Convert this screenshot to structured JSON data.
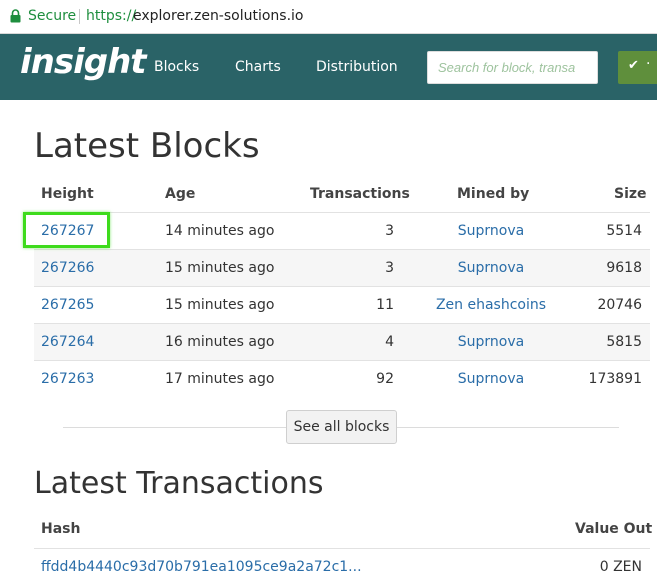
{
  "browser": {
    "secure_label": "Secure",
    "url_protocol": "https://",
    "url_host": "explorer.zen-solutions.io"
  },
  "navbar": {
    "logo": "insight",
    "links": [
      "Blocks",
      "Charts",
      "Distribution"
    ],
    "search_placeholder": "Search for block, transa",
    "status_button_text": "·"
  },
  "latest_blocks": {
    "title": "Latest Blocks",
    "columns": [
      "Height",
      "Age",
      "Transactions",
      "Mined by",
      "Size"
    ],
    "rows": [
      {
        "height": "267267",
        "age": "14 minutes ago",
        "transactions": "3",
        "mined_by": "Suprnova",
        "size": "5514"
      },
      {
        "height": "267266",
        "age": "15 minutes ago",
        "transactions": "3",
        "mined_by": "Suprnova",
        "size": "9618"
      },
      {
        "height": "267265",
        "age": "15 minutes ago",
        "transactions": "11",
        "mined_by": "Zen ehashcoins",
        "size": "20746"
      },
      {
        "height": "267264",
        "age": "16 minutes ago",
        "transactions": "4",
        "mined_by": "Suprnova",
        "size": "5815"
      },
      {
        "height": "267263",
        "age": "17 minutes ago",
        "transactions": "92",
        "mined_by": "Suprnova",
        "size": "173891"
      }
    ],
    "see_all_label": "See all blocks"
  },
  "latest_transactions": {
    "title": "Latest Transactions",
    "columns": [
      "Hash",
      "Value Out"
    ],
    "rows": [
      {
        "hash": "ffdd4b4440c93d70b791ea1095ce9a2a72c1...",
        "value_out": "0 ZEN"
      }
    ]
  },
  "colors": {
    "navbar_bg": "#2a6367",
    "link": "#2a6da8",
    "secure_green": "#1e8e3e",
    "highlight_green": "#3edb1c",
    "status_button": "#5f8f3c"
  }
}
